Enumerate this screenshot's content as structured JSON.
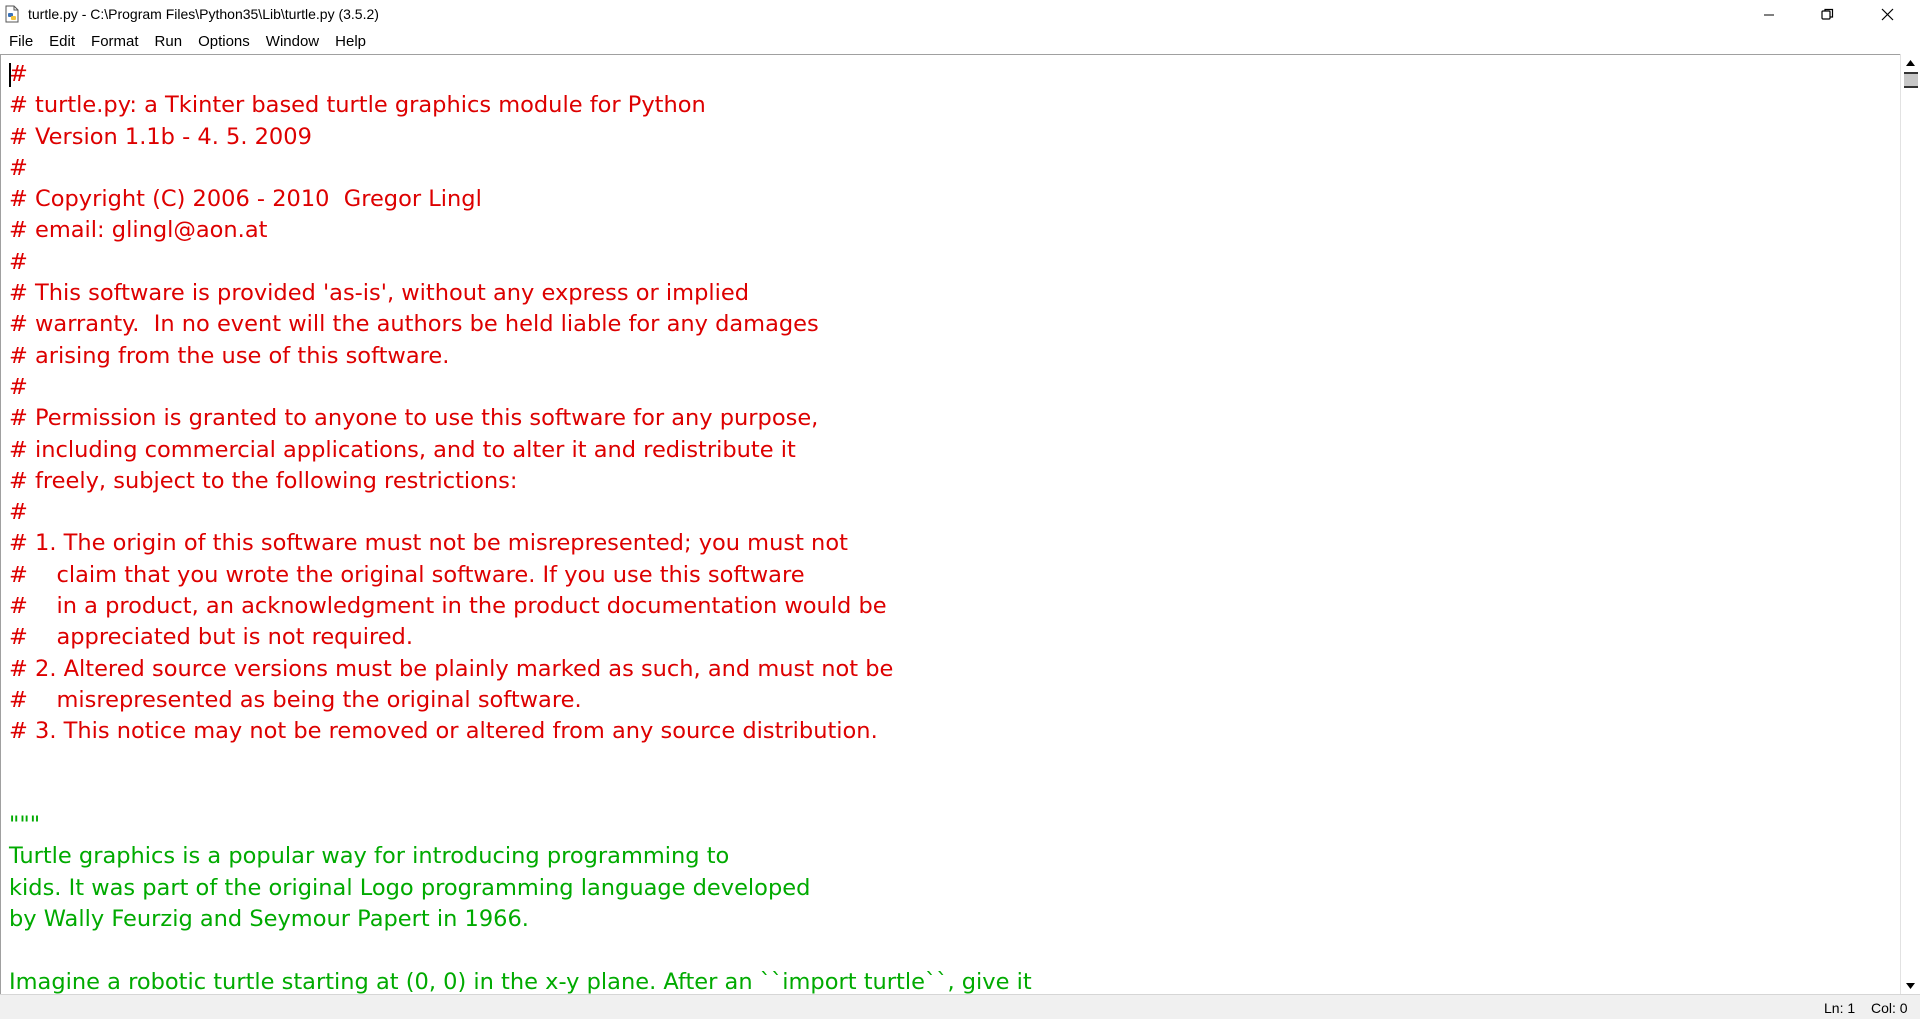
{
  "window": {
    "title": "turtle.py - C:\\Program Files\\Python35\\Lib\\turtle.py (3.5.2)",
    "icon": "python-file-icon",
    "controls": [
      "minimize-icon",
      "restore-icon",
      "close-icon"
    ]
  },
  "menu": {
    "items": [
      "File",
      "Edit",
      "Format",
      "Run",
      "Options",
      "Window",
      "Help"
    ]
  },
  "editor": {
    "comment_color": "#dd0000",
    "string_color": "#00aa00",
    "lines": [
      {
        "text": "#",
        "kind": "comment"
      },
      {
        "text": "# turtle.py: a Tkinter based turtle graphics module for Python",
        "kind": "comment"
      },
      {
        "text": "# Version 1.1b - 4. 5. 2009",
        "kind": "comment"
      },
      {
        "text": "#",
        "kind": "comment"
      },
      {
        "text": "# Copyright (C) 2006 - 2010  Gregor Lingl",
        "kind": "comment"
      },
      {
        "text": "# email: glingl@aon.at",
        "kind": "comment"
      },
      {
        "text": "#",
        "kind": "comment"
      },
      {
        "text": "# This software is provided 'as-is', without any express or implied",
        "kind": "comment"
      },
      {
        "text": "# warranty.  In no event will the authors be held liable for any damages",
        "kind": "comment"
      },
      {
        "text": "# arising from the use of this software.",
        "kind": "comment"
      },
      {
        "text": "#",
        "kind": "comment"
      },
      {
        "text": "# Permission is granted to anyone to use this software for any purpose,",
        "kind": "comment"
      },
      {
        "text": "# including commercial applications, and to alter it and redistribute it",
        "kind": "comment"
      },
      {
        "text": "# freely, subject to the following restrictions:",
        "kind": "comment"
      },
      {
        "text": "#",
        "kind": "comment"
      },
      {
        "text": "# 1. The origin of this software must not be misrepresented; you must not",
        "kind": "comment"
      },
      {
        "text": "#    claim that you wrote the original software. If you use this software",
        "kind": "comment"
      },
      {
        "text": "#    in a product, an acknowledgment in the product documentation would be",
        "kind": "comment"
      },
      {
        "text": "#    appreciated but is not required.",
        "kind": "comment"
      },
      {
        "text": "# 2. Altered source versions must be plainly marked as such, and must not be",
        "kind": "comment"
      },
      {
        "text": "#    misrepresented as being the original software.",
        "kind": "comment"
      },
      {
        "text": "# 3. This notice may not be removed or altered from any source distribution.",
        "kind": "comment"
      },
      {
        "text": "",
        "kind": "plain"
      },
      {
        "text": "",
        "kind": "plain"
      },
      {
        "text": "\"\"\"",
        "kind": "string"
      },
      {
        "text": "Turtle graphics is a popular way for introducing programming to",
        "kind": "string"
      },
      {
        "text": "kids. It was part of the original Logo programming language developed",
        "kind": "string"
      },
      {
        "text": "by Wally Feurzig and Seymour Papert in 1966.",
        "kind": "string"
      },
      {
        "text": "",
        "kind": "plain"
      },
      {
        "text": "Imagine a robotic turtle starting at (0, 0) in the x-y plane. After an ``import turtle``, give it",
        "kind": "string"
      }
    ]
  },
  "status": {
    "line": "Ln: 1",
    "col": "Col: 0"
  }
}
